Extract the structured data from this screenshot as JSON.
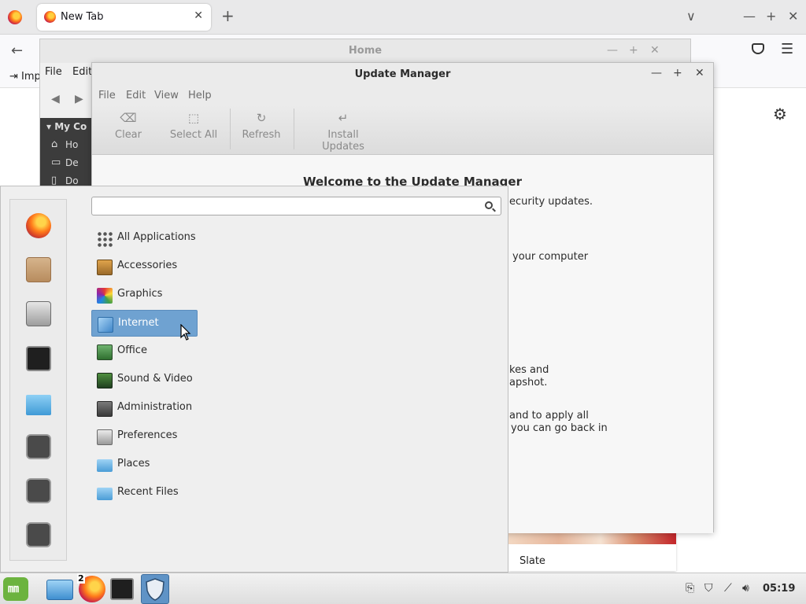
{
  "firefox": {
    "tab_title": "New Tab",
    "tab_close": "✕",
    "new_tab": "+",
    "win_min": "—",
    "win_max": "+",
    "win_close": "✕",
    "tabs_menu": "∨",
    "back": "←",
    "bookmark_import": "Imp",
    "menu_icon": "☰",
    "gear_icon": "⚙",
    "card_label": "Slate"
  },
  "nemo": {
    "title": "Home",
    "menu": [
      "File",
      "Edit"
    ],
    "sidebar_header": "My Co",
    "sidebar_items": [
      "Ho",
      "De",
      "Do"
    ],
    "ctl_min": "—",
    "ctl_max": "+",
    "ctl_close": "✕"
  },
  "update_manager": {
    "title": "Update Manager",
    "ctl_min": "—",
    "ctl_max": "+",
    "ctl_close": "✕",
    "menu": [
      "File",
      "Edit",
      "View",
      "Help"
    ],
    "toolbar": [
      {
        "label": "Clear",
        "icon": "⌫"
      },
      {
        "label": "Select All",
        "icon": "⬚"
      },
      {
        "label": "Refresh",
        "icon": "↻"
      },
      {
        "label": "Install Updates",
        "icon": "↵"
      }
    ],
    "welcome_heading": "Welcome to the Update Manager",
    "visible_lines": [
      "ecurity updates.",
      "your computer",
      "kes and",
      "apshot.",
      "and to apply all",
      "you can go back in"
    ]
  },
  "mint_menu": {
    "favorites": [
      "firefox-icon",
      "software-manager-icon",
      "system-settings-icon",
      "terminal-icon",
      "files-icon",
      "lock-screen-icon",
      "logout-icon",
      "power-icon"
    ],
    "search_placeholder": "",
    "categories": [
      {
        "label": "All Applications",
        "icon": "all-applications-icon",
        "selected": false
      },
      {
        "label": "Accessories",
        "icon": "accessories-icon",
        "selected": false
      },
      {
        "label": "Graphics",
        "icon": "graphics-icon",
        "selected": false
      },
      {
        "label": "Internet",
        "icon": "internet-icon",
        "selected": true
      },
      {
        "label": "Office",
        "icon": "office-icon",
        "selected": false
      },
      {
        "label": "Sound & Video",
        "icon": "sound-video-icon",
        "selected": false
      },
      {
        "label": "Administration",
        "icon": "administration-icon",
        "selected": false
      },
      {
        "label": "Preferences",
        "icon": "preferences-icon",
        "selected": false
      },
      {
        "label": "Places",
        "icon": "places-icon",
        "selected": false
      },
      {
        "label": "Recent Files",
        "icon": "recent-files-icon",
        "selected": false
      }
    ]
  },
  "taskbar": {
    "firefox_badge": "2",
    "clock": "05:19",
    "tray": [
      "clipboard-icon",
      "shield-icon",
      "network-icon",
      "volume-icon"
    ]
  }
}
